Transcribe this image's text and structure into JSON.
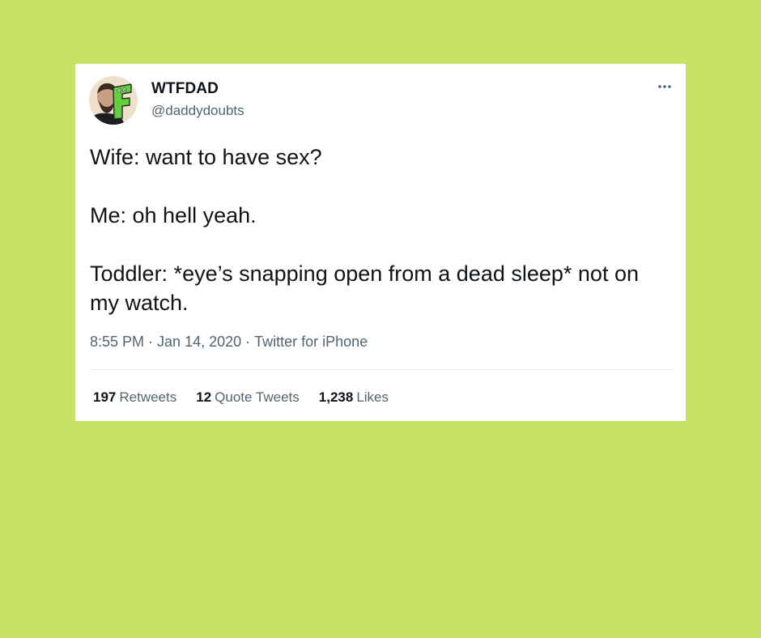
{
  "colors": {
    "background": "#c9e266",
    "card": "#ffffff",
    "text_primary": "#0f1419",
    "text_secondary": "#536471"
  },
  "author": {
    "display_name": "WTFDAD",
    "handle": "@daddydoubts",
    "avatar_icon": "avatar-photo-with-green-f-logo"
  },
  "tweet": {
    "lines": [
      "Wife: want to have sex?",
      "Me: oh hell yeah.",
      "Toddler: *eye’s snapping open from a dead sleep* not on my watch."
    ],
    "time": "8:55 PM",
    "date": "Jan 14, 2020",
    "source": "Twitter for iPhone",
    "separator": "·"
  },
  "stats": {
    "retweets_count": "197",
    "retweets_label": "Retweets",
    "quotes_count": "12",
    "quotes_label": "Quote Tweets",
    "likes_count": "1,238",
    "likes_label": "Likes"
  },
  "icons": {
    "more": "more-horizontal-icon"
  }
}
